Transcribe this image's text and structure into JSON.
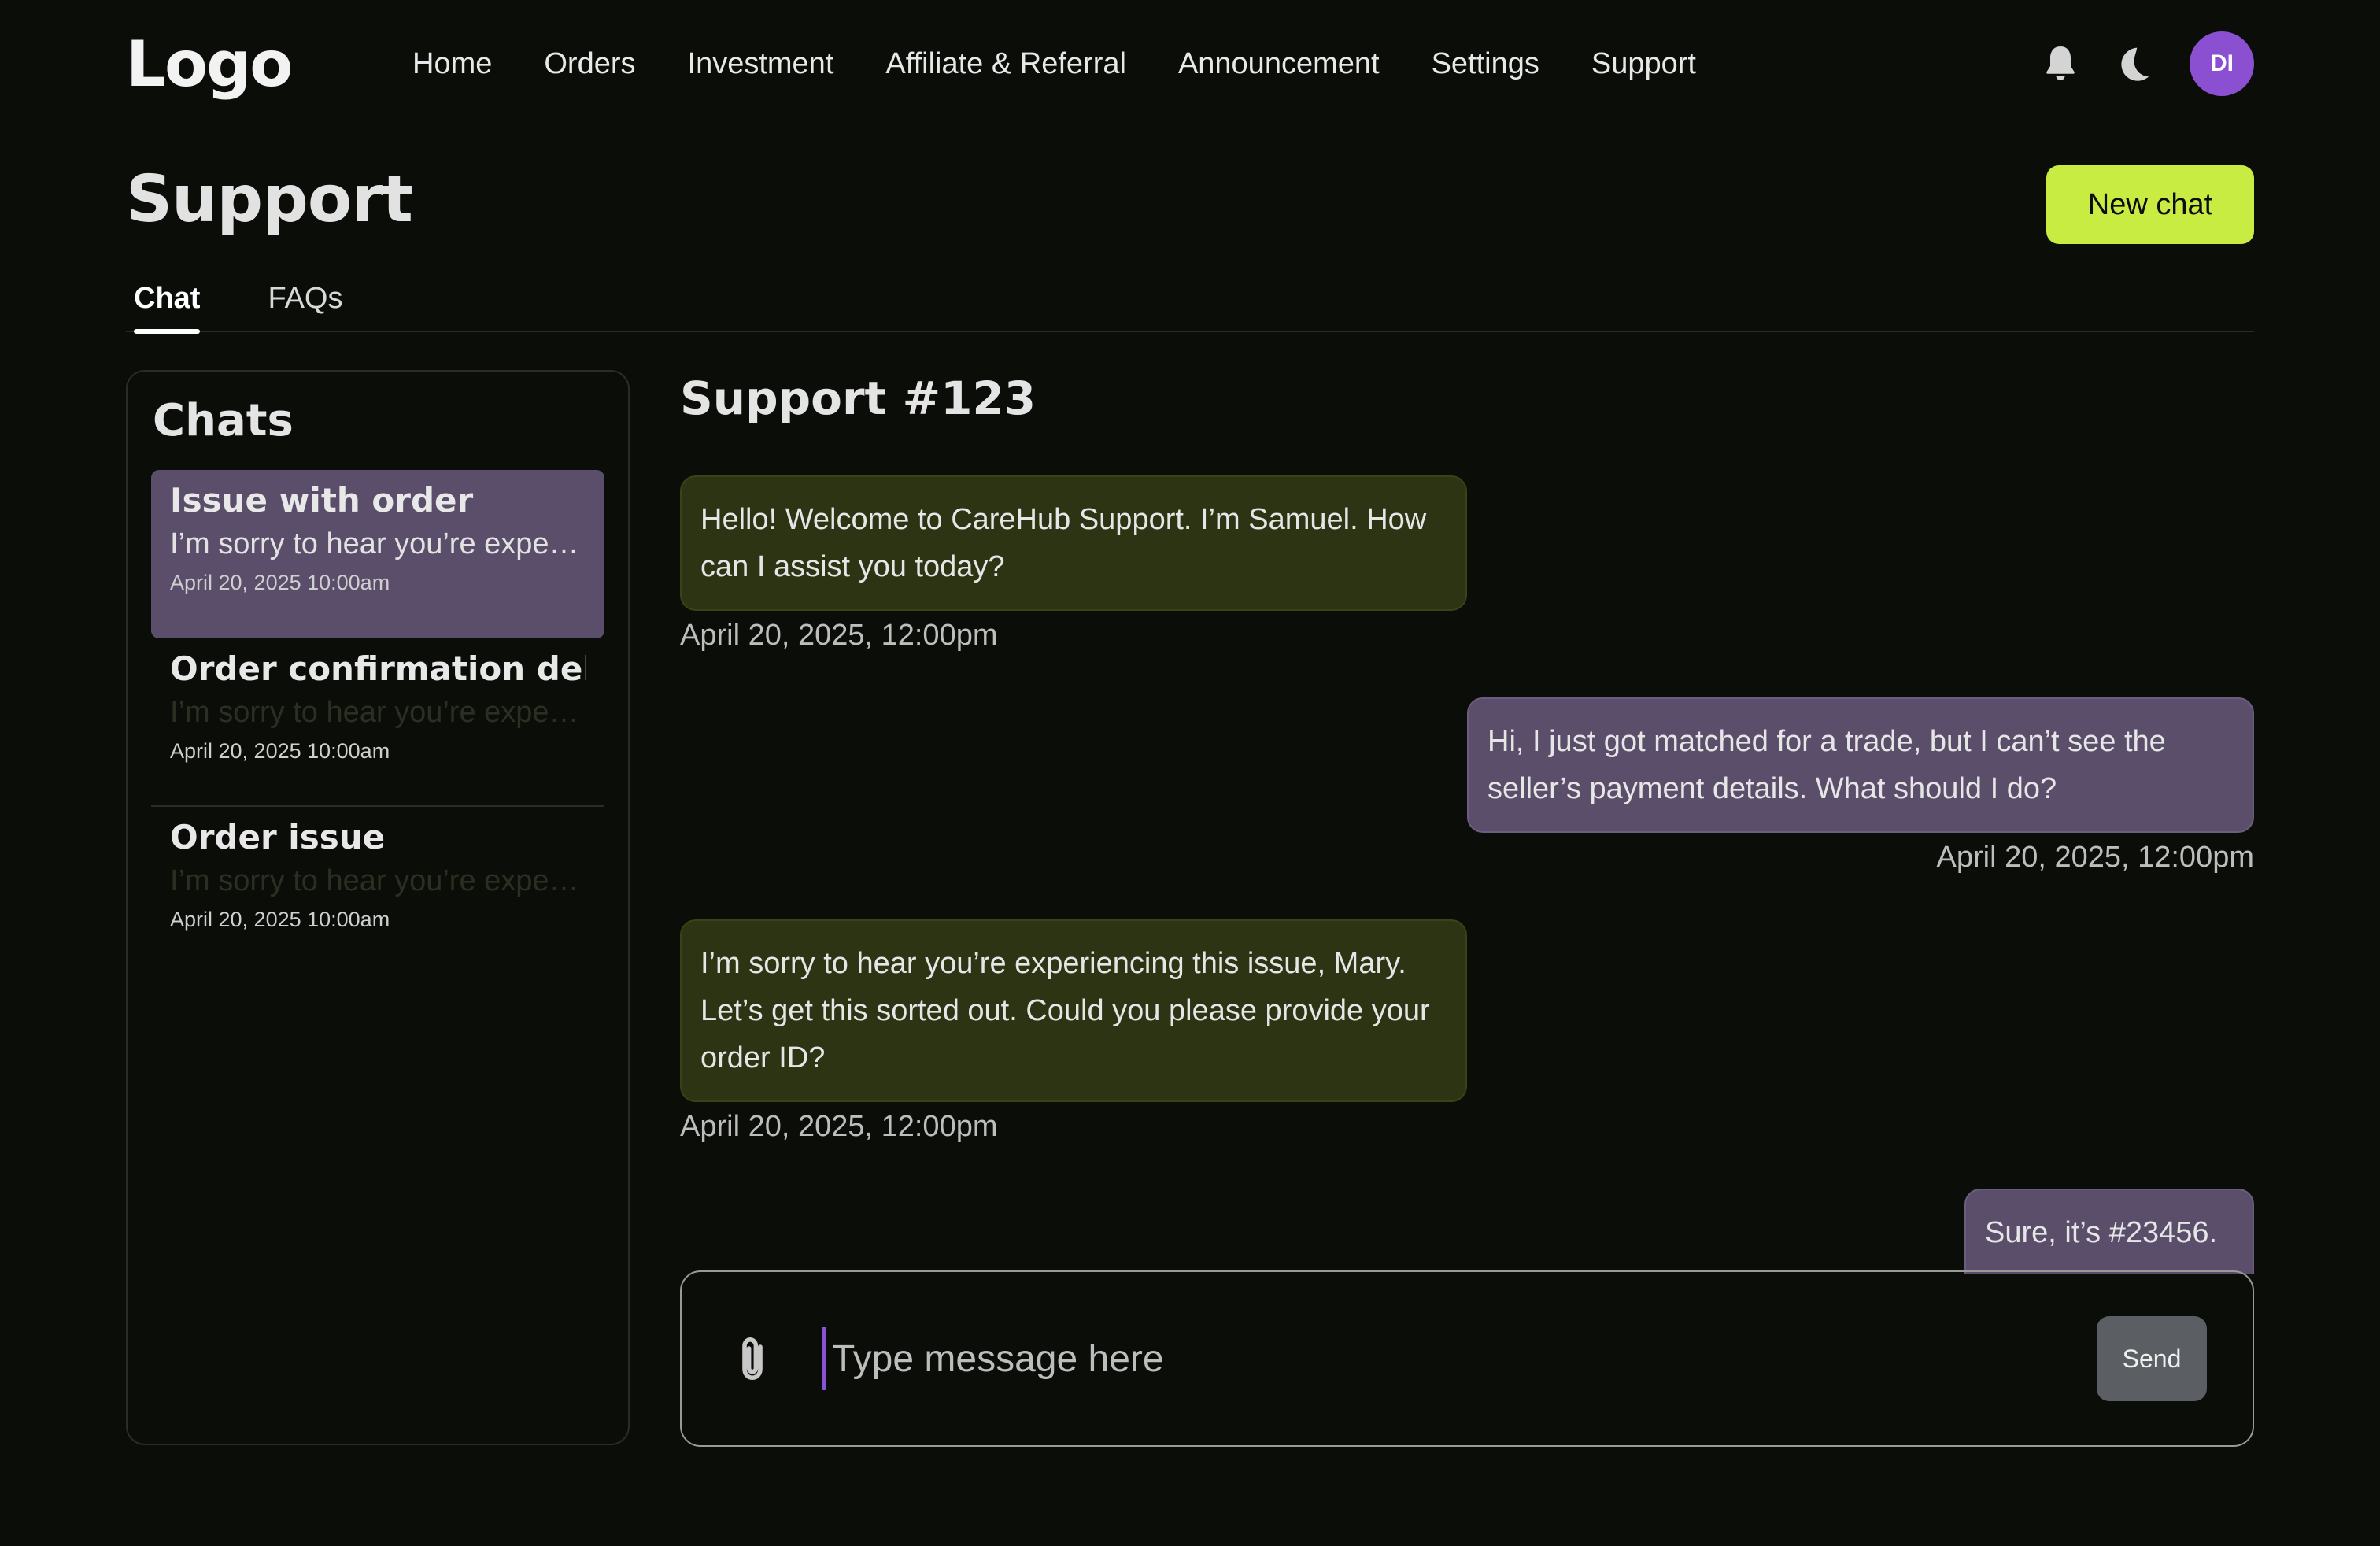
{
  "brand": {
    "logo": "Logo"
  },
  "nav": {
    "items": [
      "Home",
      "Orders",
      "Investment",
      "Affiliate & Referral",
      "Announcement",
      "Settings",
      "Support"
    ],
    "avatar_initials": "DI"
  },
  "page": {
    "title": "Support",
    "new_chat_label": "New chat",
    "tabs": [
      {
        "label": "Chat",
        "active": true
      },
      {
        "label": "FAQs",
        "active": false
      }
    ]
  },
  "chats": {
    "heading": "Chats",
    "items": [
      {
        "title": "Issue with order",
        "preview": "I’m sorry to hear you’re experiencing this issue, Mary.",
        "time": "April 20, 2025 10:00am"
      },
      {
        "title": "Order confirmation delay",
        "preview": "I’m sorry to hear you’re experiencing this issue, Mary.",
        "time": "April 20, 2025 10:00am"
      },
      {
        "title": "Order issue",
        "preview": "I’m sorry to hear you’re experiencing this issue, Mary.",
        "time": "April 20, 2025 10:00am"
      }
    ]
  },
  "conversation": {
    "title": "Support #123",
    "messages": [
      {
        "from": "support",
        "text": "Hello! Welcome to CareHub Support. I’m Samuel. How can I assist you today?",
        "time": "April 20, 2025, 12:00pm"
      },
      {
        "from": "user",
        "text": "Hi, I just got matched for a trade, but I can’t see the seller’s payment details. What should I do?",
        "time": "April 20, 2025, 12:00pm"
      },
      {
        "from": "support",
        "text": "I’m sorry to hear you’re experiencing this issue, Mary. Let’s get this sorted out. Could you please provide your order ID?",
        "time": "April 20, 2025, 12:00pm"
      },
      {
        "from": "user",
        "text": "Sure, it’s #23456."
      }
    ],
    "composer": {
      "placeholder": "Type message here",
      "send_label": "Send"
    }
  },
  "icons": {
    "notifications": "bell-icon",
    "theme": "moon-icon",
    "attach": "paperclip-icon"
  },
  "colors": {
    "background": "#0b0d09",
    "accent": "#c9ec43",
    "avatar": "#8b4fd1",
    "support_bubble": "#2d3414",
    "user_bubble": "#5a4e6a",
    "active_chat": "#5a4e6a",
    "send_button": "#5b5f63",
    "dim_preview": "#2a2f22"
  }
}
